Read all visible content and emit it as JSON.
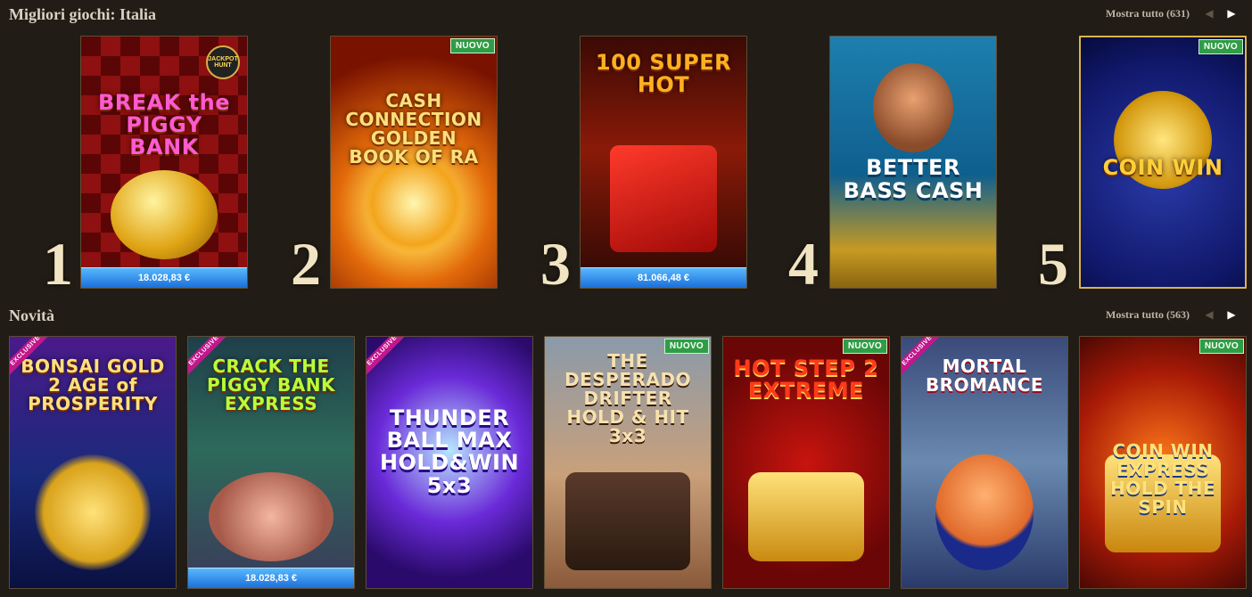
{
  "top_section": {
    "title": "Migliori giochi: Italia",
    "show_all": "Mostra tutto (631)",
    "ranks": [
      "1",
      "2",
      "3",
      "4",
      "5"
    ],
    "games": [
      {
        "title": "BREAK the PIGGY BANK",
        "logo": "JACKPOT HUNT",
        "jackpot": "18.028,83 €"
      },
      {
        "title": "CASH CONNECTION GOLDEN BOOK OF RA",
        "badge": "NUOVO"
      },
      {
        "title": "100 SUPER HOT",
        "jackpot": "81.066,48 €"
      },
      {
        "title": "BETTER BASS CASH"
      },
      {
        "title": "COIN WIN",
        "badge": "NUOVO"
      }
    ]
  },
  "new_section": {
    "title": "Novità",
    "show_all": "Mostra tutto (563)",
    "games": [
      {
        "title": "BONSAI GOLD 2 AGE of PROSPERITY",
        "ribbon": "EXCLUSIVE"
      },
      {
        "title": "CRACK THE PIGGY BANK EXPRESS",
        "ribbon": "EXCLUSIVE",
        "jackpot": "18.028,83 €"
      },
      {
        "title": "THUNDER BALL MAX HOLD&WIN 5x3",
        "ribbon": "EXCLUSIVE"
      },
      {
        "title": "THE DESPERADO DRIFTER HOLD & HIT 3x3",
        "badge": "NUOVO"
      },
      {
        "title": "HOT STEP 2 EXTREME",
        "badge": "NUOVO"
      },
      {
        "title": "MORTAL BROMANCE",
        "ribbon": "EXCLUSIVE"
      },
      {
        "title": "COIN WIN EXPRESS HOLD THE SPIN",
        "badge": "NUOVO"
      }
    ]
  },
  "icons": {
    "prev": "chevron-left-icon",
    "next": "chevron-right-icon"
  }
}
